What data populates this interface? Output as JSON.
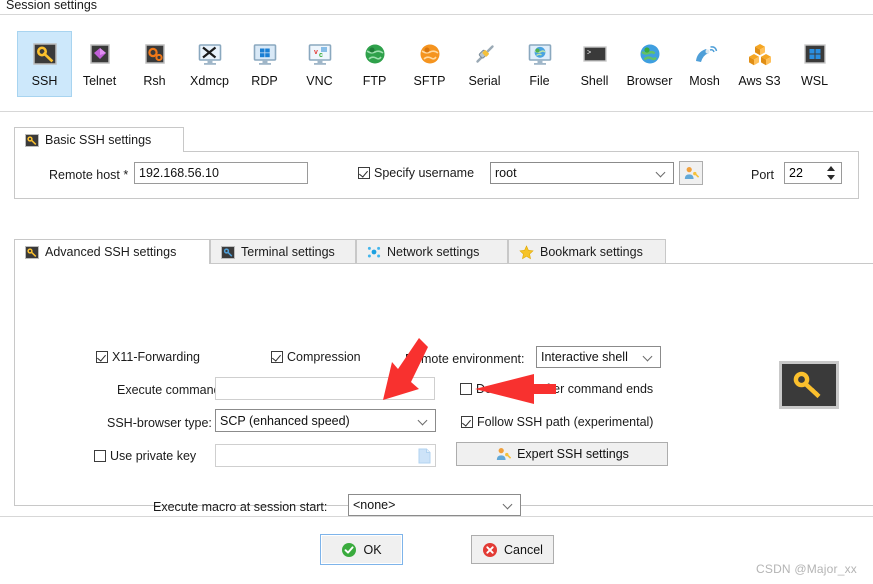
{
  "window": {
    "title": "Session settings"
  },
  "session_types": [
    {
      "id": "ssh",
      "label": "SSH",
      "icon": "key-icon",
      "selected": true
    },
    {
      "id": "telnet",
      "label": "Telnet",
      "icon": "gem-icon",
      "selected": false
    },
    {
      "id": "rsh",
      "label": "Rsh",
      "icon": "gears-icon",
      "selected": false
    },
    {
      "id": "xdmcp",
      "label": "Xdmcp",
      "icon": "x-monitor-icon",
      "selected": false
    },
    {
      "id": "rdp",
      "label": "RDP",
      "icon": "windows-monitor-icon",
      "selected": false
    },
    {
      "id": "vnc",
      "label": "VNC",
      "icon": "vnc-monitor-icon",
      "selected": false
    },
    {
      "id": "ftp",
      "label": "FTP",
      "icon": "green-globe-icon",
      "selected": false
    },
    {
      "id": "sftp",
      "label": "SFTP",
      "icon": "orange-globe-icon",
      "selected": false
    },
    {
      "id": "serial",
      "label": "Serial",
      "icon": "plug-icon",
      "selected": false
    },
    {
      "id": "file",
      "label": "File",
      "icon": "globe-monitor-icon",
      "selected": false
    },
    {
      "id": "shell",
      "label": "Shell",
      "icon": "terminal-icon",
      "selected": false
    },
    {
      "id": "browser",
      "label": "Browser",
      "icon": "blue-globe-icon",
      "selected": false
    },
    {
      "id": "mosh",
      "label": "Mosh",
      "icon": "satellite-icon",
      "selected": false
    },
    {
      "id": "awss3",
      "label": "Aws S3",
      "icon": "cubes-icon",
      "selected": false
    },
    {
      "id": "wsl",
      "label": "WSL",
      "icon": "windows-icon",
      "selected": false
    }
  ],
  "basic": {
    "tab_label": "Basic SSH settings",
    "tab_icon": "key-icon",
    "remote_host_label": "Remote host *",
    "remote_host_value": "192.168.56.10",
    "specify_username_label": "Specify username",
    "specify_username_checked": true,
    "username_value": "root",
    "user_button_icon": "user-key-icon",
    "port_label": "Port",
    "port_value": "22"
  },
  "advanced": {
    "tabs": [
      {
        "id": "advanced-ssh",
        "label": "Advanced SSH settings",
        "icon": "key-icon",
        "active": true
      },
      {
        "id": "terminal",
        "label": "Terminal settings",
        "icon": "terminal-blue-icon",
        "active": false
      },
      {
        "id": "network",
        "label": "Network settings",
        "icon": "network-dots-icon",
        "active": false
      },
      {
        "id": "bookmark",
        "label": "Bookmark settings",
        "icon": "star-icon",
        "active": false
      }
    ],
    "x11_forwarding_label": "X11-Forwarding",
    "x11_forwarding_checked": true,
    "compression_label": "Compression",
    "compression_checked": true,
    "remote_environment_label": "Remote environment:",
    "remote_environment_value": "Interactive shell",
    "execute_command_label": "Execute command:",
    "execute_command_value": "",
    "do_not_exit_label": "Do not exit after command ends",
    "do_not_exit_checked": false,
    "ssh_browser_type_label": "SSH-browser type:",
    "ssh_browser_type_value": "SCP (enhanced speed)",
    "follow_ssh_path_label": "Follow SSH path (experimental)",
    "follow_ssh_path_checked": true,
    "use_private_key_label": "Use private key",
    "use_private_key_checked": false,
    "use_private_key_value": "",
    "private_key_browse_icon": "file-icon",
    "expert_button_label": "Expert SSH settings",
    "expert_button_icon": "user-key-icon",
    "execute_macro_label": "Execute macro at session start:",
    "execute_macro_value": "<none>",
    "decoration_icon": "key-icon"
  },
  "footer": {
    "ok_label": "OK",
    "ok_icon": "green-check-icon",
    "cancel_label": "Cancel",
    "cancel_icon": "red-x-icon"
  },
  "watermark": {
    "text": "CSDN @Major_xx"
  },
  "annotations": [
    {
      "id": "arrow-to-ssh-browser-type",
      "color": "#f8312f"
    },
    {
      "id": "arrow-to-follow-ssh-path",
      "color": "#f8312f"
    }
  ],
  "colors": {
    "selection": "#cde8fb",
    "accent_key": "#fbc02d",
    "annotation": "#f8312f",
    "ok_green": "#3aab3e",
    "cancel_red": "#e23b35"
  }
}
